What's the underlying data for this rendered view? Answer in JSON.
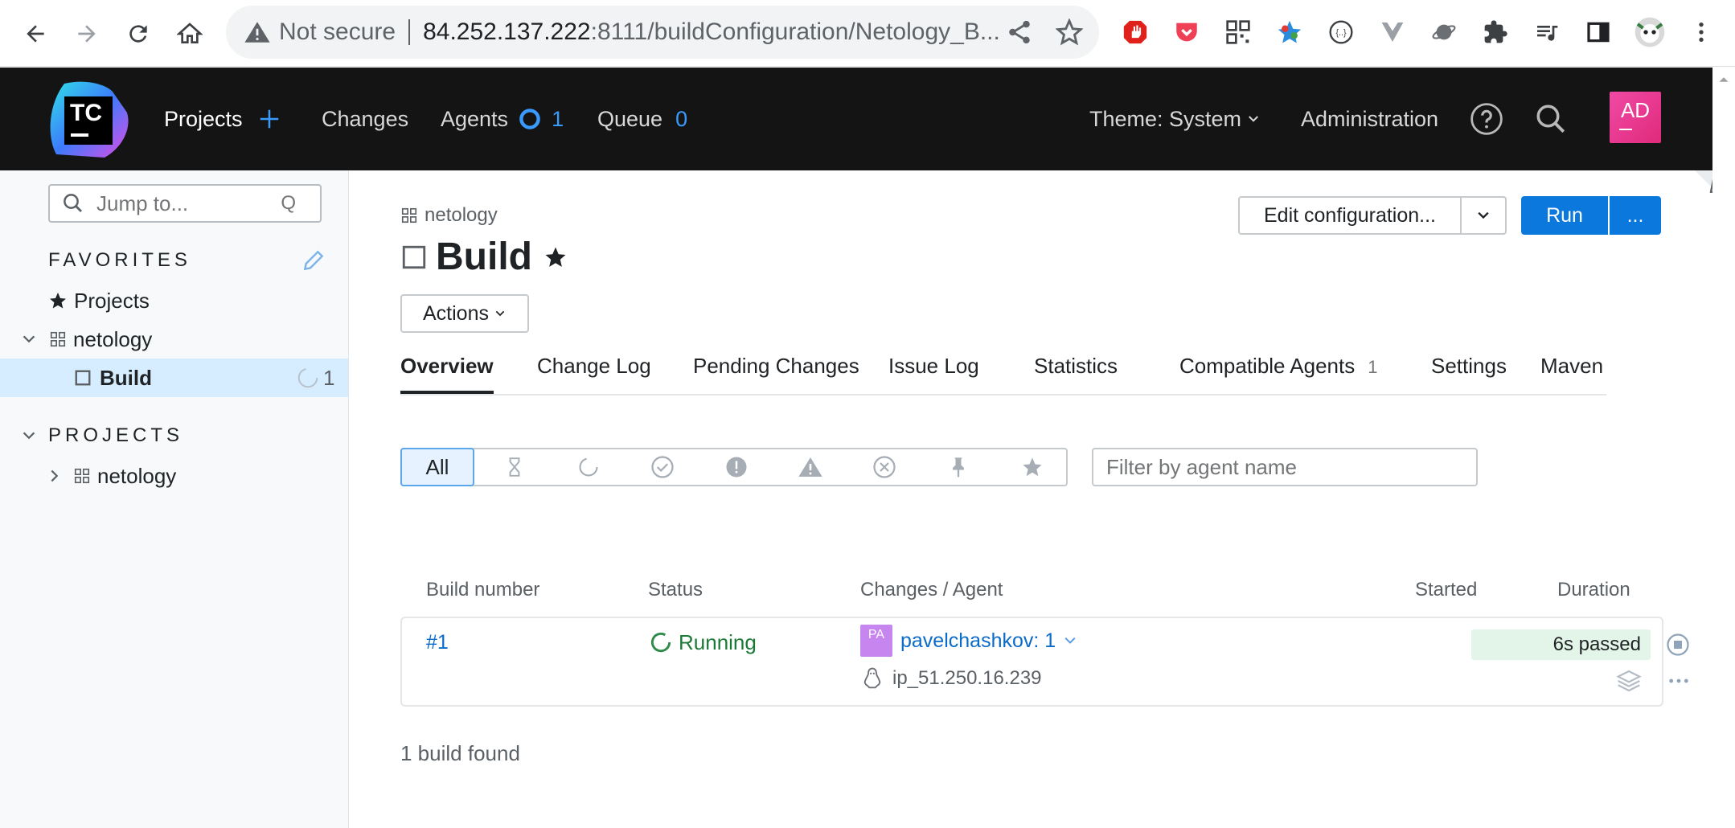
{
  "browser": {
    "security_label": "Not secure",
    "url_host": "84.252.137.222",
    "url_path": ":8111/buildConfiguration/Netology_B..."
  },
  "topbar": {
    "logo_text": "TC",
    "projects_label": "Projects",
    "changes_label": "Changes",
    "agents_label": "Agents",
    "agents_count": "1",
    "queue_label": "Queue",
    "queue_count": "0",
    "theme_label": "Theme: System",
    "admin_label": "Administration",
    "avatar_initials": "AD"
  },
  "sidebar": {
    "search_placeholder": "Jump to...",
    "search_shortcut": "Q",
    "favorites_title": "FAVORITES",
    "favorites_projects": "Projects",
    "fav_project": "netology",
    "fav_build": "Build",
    "fav_build_count": "1",
    "projects_title": "PROJECTS",
    "project_item": "netology"
  },
  "page": {
    "breadcrumb": "netology",
    "title": "Build",
    "actions_label": "Actions",
    "edit_config_label": "Edit configuration...",
    "run_label": "Run",
    "more_label": "..."
  },
  "tabs": [
    {
      "label": "Overview"
    },
    {
      "label": "Change Log"
    },
    {
      "label": "Pending Changes"
    },
    {
      "label": "Issue Log"
    },
    {
      "label": "Statistics"
    },
    {
      "label": "Compatible Agents",
      "count": "1"
    },
    {
      "label": "Settings"
    },
    {
      "label": "Maven"
    }
  ],
  "filters": {
    "all_label": "All",
    "agent_placeholder": "Filter by agent name"
  },
  "table": {
    "headers": [
      "Build number",
      "Status",
      "Changes / Agent",
      "Started",
      "Duration"
    ],
    "rows": [
      {
        "number": "#1",
        "status": "Running",
        "user_initials": "PA",
        "changes": "pavelchashkov: 1",
        "agent": "ip_51.250.16.239",
        "duration": "6s passed"
      }
    ],
    "found_text": "1 build found"
  },
  "colors": {
    "accent": "#0b78dd",
    "running": "#1a8a3a",
    "topbar_bg": "#141414",
    "avatar": "#e6318c"
  }
}
